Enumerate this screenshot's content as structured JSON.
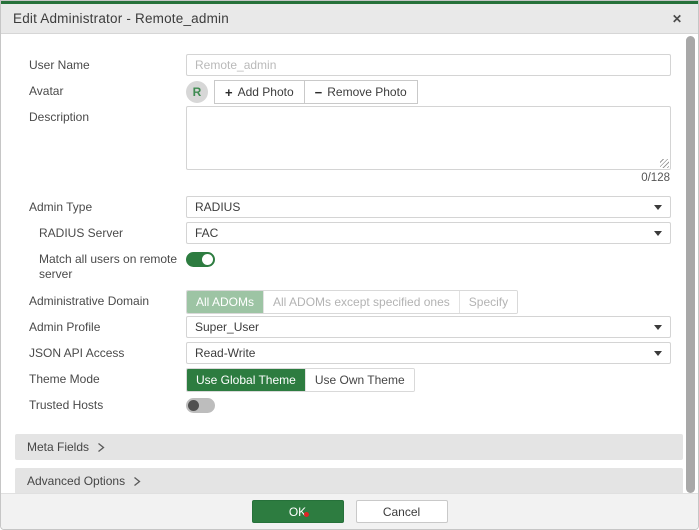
{
  "dialog": {
    "title": "Edit Administrator - Remote_admin",
    "close_icon": "✕"
  },
  "form": {
    "user_name": {
      "label": "User Name",
      "value": "Remote_admin"
    },
    "avatar": {
      "label": "Avatar",
      "initial": "R",
      "plus_icon": "+",
      "minus_icon": "−",
      "add_photo_label": "Add Photo",
      "remove_photo_label": "Remove Photo"
    },
    "description": {
      "label": "Description",
      "value": "",
      "counter": "0/128"
    },
    "admin_type": {
      "label": "Admin Type",
      "value": "RADIUS"
    },
    "radius_server": {
      "label": "RADIUS Server",
      "value": "FAC"
    },
    "match_all_users": {
      "label": "Match all users on remote server",
      "state": "on"
    },
    "administrative_domain": {
      "label": "Administrative Domain",
      "selected": "All ADOMs",
      "options": [
        "All ADOMs",
        "All ADOMs except specified ones",
        "Specify"
      ]
    },
    "admin_profile": {
      "label": "Admin Profile",
      "value": "Super_User"
    },
    "json_api_access": {
      "label": "JSON API Access",
      "value": "Read-Write"
    },
    "theme_mode": {
      "label": "Theme Mode",
      "selected": "Use Global Theme",
      "options": [
        "Use Global Theme",
        "Use Own Theme"
      ]
    },
    "trusted_hosts": {
      "label": "Trusted Hosts",
      "state": "off"
    }
  },
  "sections": {
    "meta_fields": "Meta Fields",
    "advanced_options": "Advanced Options"
  },
  "footer": {
    "ok_label": "OK",
    "cancel_label": "Cancel"
  },
  "colors": {
    "primary_green": "#2d7c40",
    "muted_green": "#9dc4a4",
    "top_accent_green": "#26713a"
  }
}
